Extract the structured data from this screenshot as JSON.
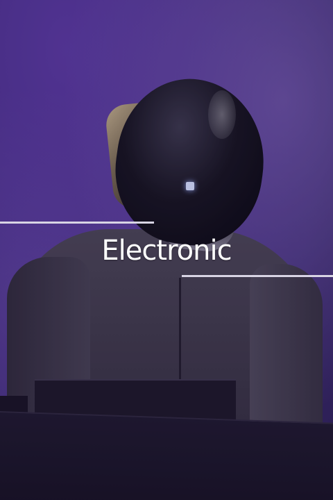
{
  "category": {
    "title": "Electronic"
  },
  "background": {
    "image": "performer-photo",
    "accent_color": "#4a3088"
  }
}
